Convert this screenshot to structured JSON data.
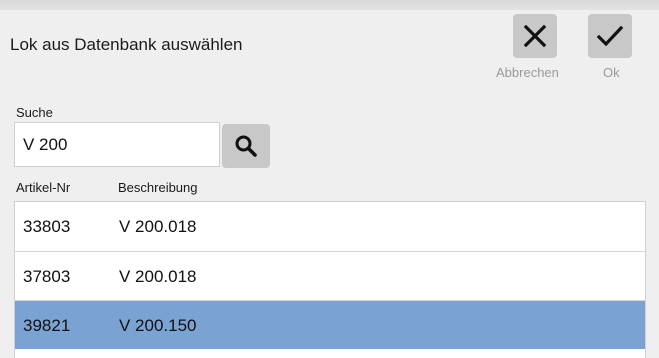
{
  "dialog": {
    "title": "Lok aus Datenbank auswählen",
    "cancel_label": "Abbrechen",
    "ok_label": "Ok"
  },
  "search": {
    "label": "Suche",
    "value": "V 200"
  },
  "columns": {
    "nr": "Artikel-Nr",
    "desc": "Beschreibung"
  },
  "rows": [
    {
      "nr": "33803",
      "desc": "V 200.018",
      "selected": false
    },
    {
      "nr": "37803",
      "desc": "V 200.018",
      "selected": false
    },
    {
      "nr": "39821",
      "desc": "V 200.150",
      "selected": true
    }
  ],
  "colors": {
    "selected_row": "#7aa3d4",
    "button_bg": "#c8c8c8",
    "disabled_label": "#9a9a9a"
  },
  "icons": {
    "cancel": "close-icon",
    "ok": "checkmark-icon",
    "search": "search-icon"
  }
}
